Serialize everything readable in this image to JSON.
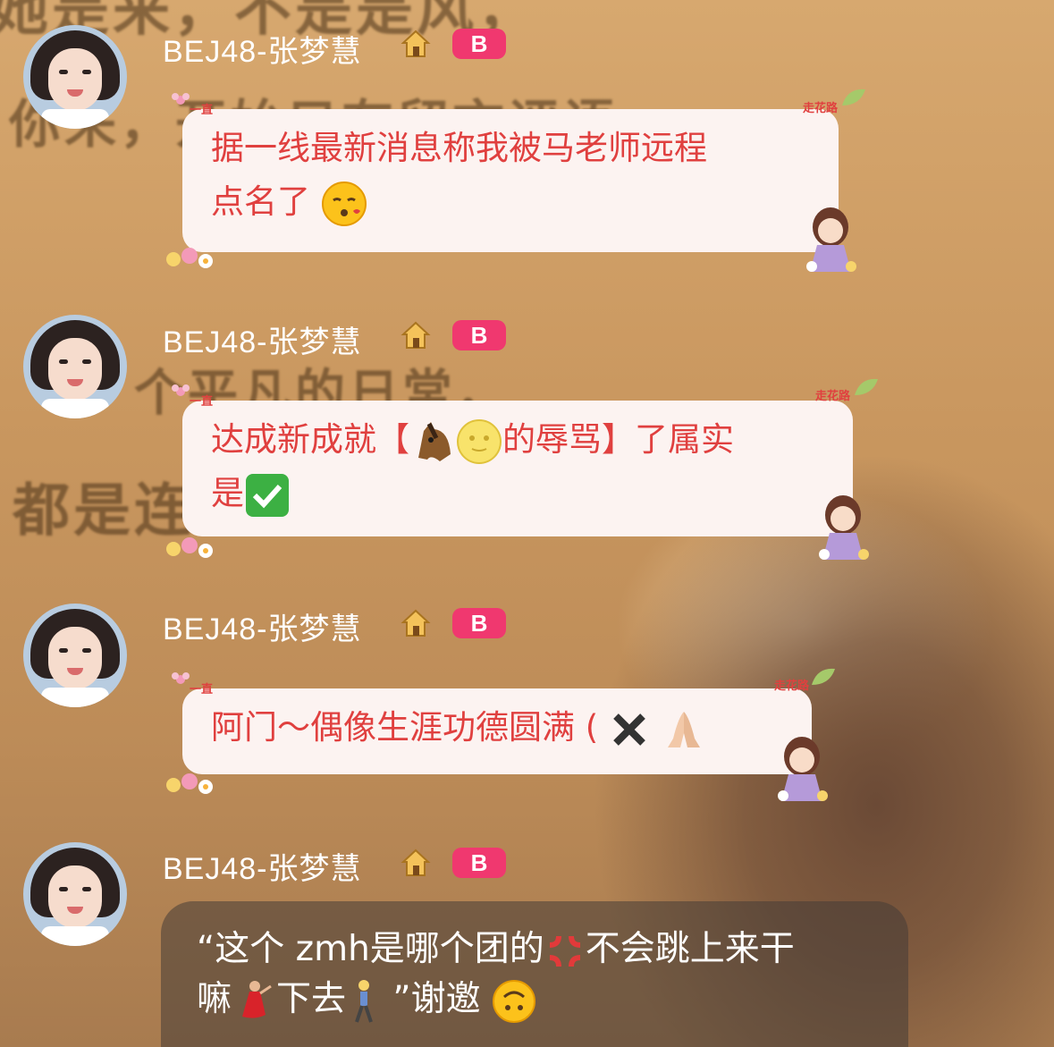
{
  "messages": [
    {
      "sender": "BEJ48-张梦慧",
      "badge": "B",
      "text_parts": [
        "据一线最新消息称我被马老师远程",
        "点名了"
      ],
      "emoji": [
        "face-blowing-kiss"
      ]
    },
    {
      "sender": "BEJ48-张梦慧",
      "badge": "B",
      "text_parts": [
        "达成新成就【",
        "的辱骂】了属实",
        "是"
      ],
      "emoji": [
        "horse-face",
        "full-moon-face",
        "check-mark-button"
      ]
    },
    {
      "sender": "BEJ48-张梦慧",
      "badge": "B",
      "text_parts": [
        "阿门～偶像生涯功德圆满 ( "
      ],
      "emoji": [
        "cross-mark",
        "folded-hands"
      ]
    },
    {
      "sender": "BEJ48-张梦慧",
      "badge": "B",
      "text_parts": [
        "“这个 zmh是哪个团的",
        "不会跳上来干",
        "嘛",
        "下去",
        " ”谢邀"
      ],
      "emoji": [
        "anger-symbol",
        "dancer",
        "person-walking",
        "upside-down-face"
      ]
    }
  ],
  "bubble_decor": {
    "top_left": "一直",
    "top_right": "走花路"
  },
  "background_text": [
    "她是来，不是是风，",
    "你来，开始只有留言评语",
    "个平凡的日常，",
    "都是连"
  ],
  "colors": {
    "name": "#ffffff",
    "badge": "#f0386f",
    "bubble_text": "#e0403f",
    "bubble_bg": "#fcf3f1"
  }
}
